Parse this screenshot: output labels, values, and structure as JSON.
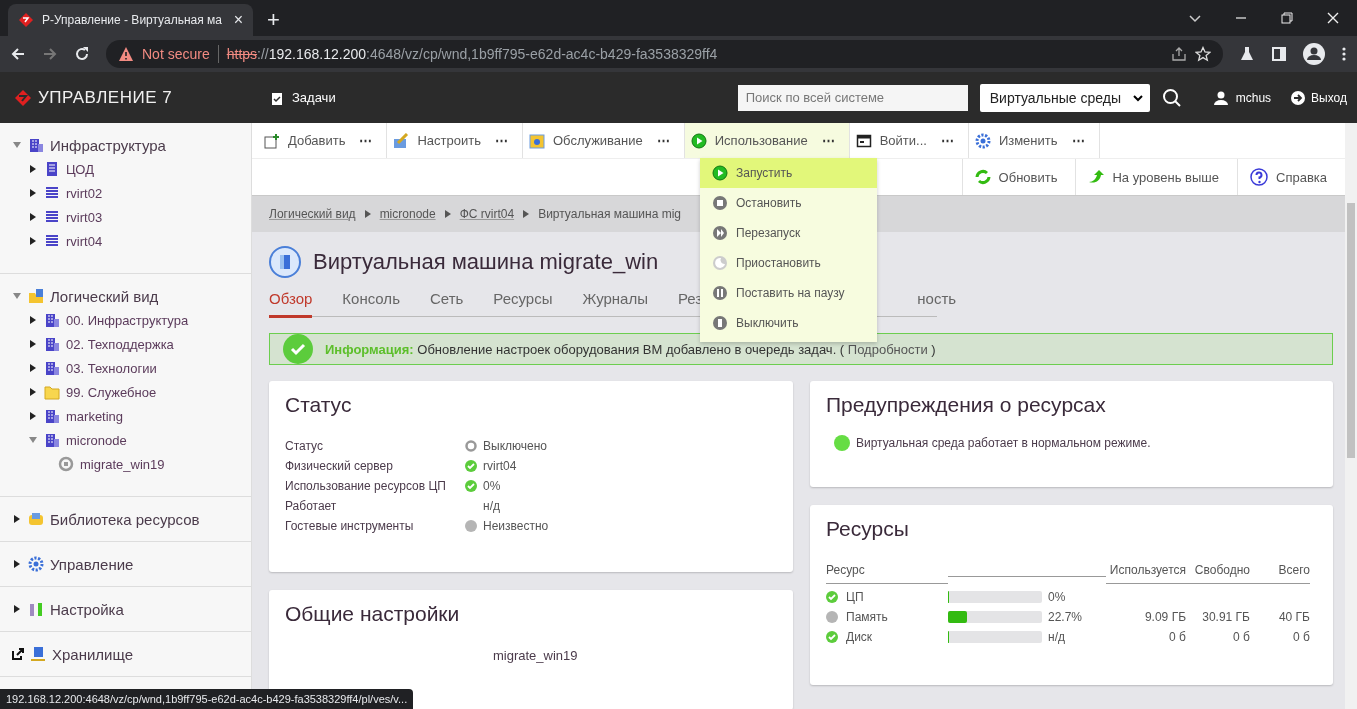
{
  "browser": {
    "tab_title": "Р-Управление - Виртуальная ма",
    "tab_close": "×",
    "new_tab": "+",
    "security": "Not secure",
    "url": [
      {
        "kind": "scheme",
        "text": "https"
      },
      {
        "kind": "plain",
        "text": "://"
      },
      {
        "kind": "host",
        "text": "192.168.12.200"
      },
      {
        "kind": "plain",
        "text": ":4648/vz/cp/wnd,1b9ff795-e62d-ac4c-b429-fa3538329ff4"
      }
    ]
  },
  "app": {
    "logo": "УПРАВЛЕНИЕ 7",
    "tasks": "Задачи",
    "search": {
      "placeholder": "Поиск по всей системе"
    },
    "scope": "Виртуальные среды",
    "user": "mchus",
    "logout": "Выход"
  },
  "sidebar": {
    "sections": [
      {
        "label": "Инфраструктура",
        "kind": "infrastructure",
        "expanded": true,
        "children": [
          {
            "label": "ЦОД",
            "kind": "datacenter",
            "expanded": false
          },
          {
            "label": "rvirt02",
            "kind": "server",
            "expanded": false
          },
          {
            "label": "rvirt03",
            "kind": "server",
            "expanded": false
          },
          {
            "label": "rvirt04",
            "kind": "server",
            "expanded": false
          }
        ]
      },
      {
        "label": "Логический вид",
        "kind": "logical",
        "expanded": true,
        "children": [
          {
            "label": "00. Инфраструктура",
            "kind": "group",
            "expanded": false
          },
          {
            "label": "02. Техподдержка",
            "kind": "group",
            "expanded": false
          },
          {
            "label": "03. Технологии",
            "kind": "group",
            "expanded": false
          },
          {
            "label": "99. Служебное",
            "kind": "folder",
            "expanded": false
          },
          {
            "label": "marketing",
            "kind": "group",
            "expanded": false
          },
          {
            "label": "micronode",
            "kind": "group",
            "expanded": true,
            "children": [
              {
                "label": "migrate_win19",
                "kind": "vm"
              }
            ]
          }
        ]
      },
      {
        "label": "Библиотека ресурсов",
        "kind": "library",
        "expanded": false
      },
      {
        "label": "Управление",
        "kind": "management",
        "expanded": false
      },
      {
        "label": "Настройка",
        "kind": "settings",
        "expanded": false
      },
      {
        "label": "Хранилище",
        "kind": "storage",
        "expanded": false
      }
    ]
  },
  "toolbar": {
    "actions": [
      {
        "label": "Добавить",
        "kind": "add",
        "more": "⋯",
        "selected": false
      },
      {
        "label": "Настроить",
        "kind": "configure",
        "more": "⋯",
        "selected": false
      },
      {
        "label": "Обслуживание",
        "kind": "service",
        "more": "⋯",
        "selected": false
      },
      {
        "label": "Использование",
        "kind": "play",
        "more": "⋯",
        "selected": true
      },
      {
        "label": "Войти...",
        "kind": "window",
        "more": "⋯",
        "selected": false
      },
      {
        "label": "Изменить",
        "kind": "gear",
        "more": "⋯",
        "selected": false
      }
    ],
    "secondary": [
      {
        "label": "Обновить",
        "kind": "refresh"
      },
      {
        "label": "На уровень выше",
        "kind": "up"
      },
      {
        "label": "Справка",
        "kind": "help"
      }
    ]
  },
  "menu": {
    "items": [
      {
        "label": "Запустить",
        "kind": "play",
        "selected": true
      },
      {
        "label": "Остановить",
        "kind": "stop",
        "selected": false
      },
      {
        "label": "Перезапуск",
        "kind": "restart",
        "selected": false
      },
      {
        "label": "Приостановить",
        "kind": "suspend",
        "selected": false
      },
      {
        "label": "Поставить на паузу",
        "kind": "pause",
        "selected": false
      },
      {
        "label": "Выключить",
        "kind": "power",
        "selected": false
      }
    ]
  },
  "breadcrumb": [
    {
      "label": "Логический вид",
      "link": true
    },
    {
      "label": "micronode",
      "link": true
    },
    {
      "label": "ФС rvirt04",
      "link": true
    },
    {
      "label": "Виртуальная машина mig",
      "link": false
    }
  ],
  "page": {
    "title": "Виртуальная машина migrate_win",
    "tabs": [
      {
        "label": "Обзор",
        "selected": true
      },
      {
        "label": "Консоль",
        "selected": false
      },
      {
        "label": "Сеть",
        "selected": false
      },
      {
        "label": "Ресурсы",
        "selected": false
      },
      {
        "label": "Журналы",
        "selected": false
      },
      {
        "label": "Рез",
        "selected": false
      },
      {
        "label": "ность",
        "selected": false
      }
    ]
  },
  "notice": {
    "label": "Информация:",
    "text": "Обновление настроек оборудования ВМ добавлено в очередь задач. (",
    "link": "Подробности",
    "tail": ")"
  },
  "status_card": {
    "title": "Статус",
    "rows": [
      {
        "label": "Статус",
        "value": "Выключено",
        "kind": "off"
      },
      {
        "label": "Физический сервер",
        "value": "rvirt04",
        "kind": "ok"
      },
      {
        "label": "Использование ресурсов ЦП",
        "value": "0%",
        "kind": "ok"
      },
      {
        "label": "Работает",
        "value": "н/д",
        "kind": "none"
      },
      {
        "label": "Гостевые инструменты",
        "value": "Неизвестно",
        "kind": "unknown"
      }
    ]
  },
  "general_card": {
    "title": "Общие настройки",
    "rows": [
      {
        "value": "migrate_win19"
      }
    ]
  },
  "warnings_card": {
    "title": "Предупреждения о ресурсах",
    "items": [
      {
        "text": "Виртуальная среда работает в нормальном режиме.",
        "color": "#66dd44"
      }
    ]
  },
  "resources_card": {
    "title": "Ресурсы",
    "columns": [
      "Ресурс",
      "Используется",
      "Свободно",
      "Всего"
    ],
    "rows": [
      {
        "name": "ЦП",
        "kind": "ok",
        "level": 0,
        "reading": "0%"
      },
      {
        "name": "Память",
        "kind": "unknown",
        "level": 0.2,
        "reading": "22.7%",
        "used": "9.09 ГБ",
        "free": "30.91 ГБ",
        "total": "40 ГБ"
      },
      {
        "name": "Диск",
        "kind": "ok",
        "level": 0,
        "reading": "н/д",
        "used": "0 б",
        "free": "0 б",
        "total": "0 б"
      }
    ]
  },
  "status_bar": {
    "url": "192.168.12.200:4648/vz/cp/wnd,1b9ff795-e62d-ac4c-b429-fa3538329ff4/pl/ves/v..."
  }
}
